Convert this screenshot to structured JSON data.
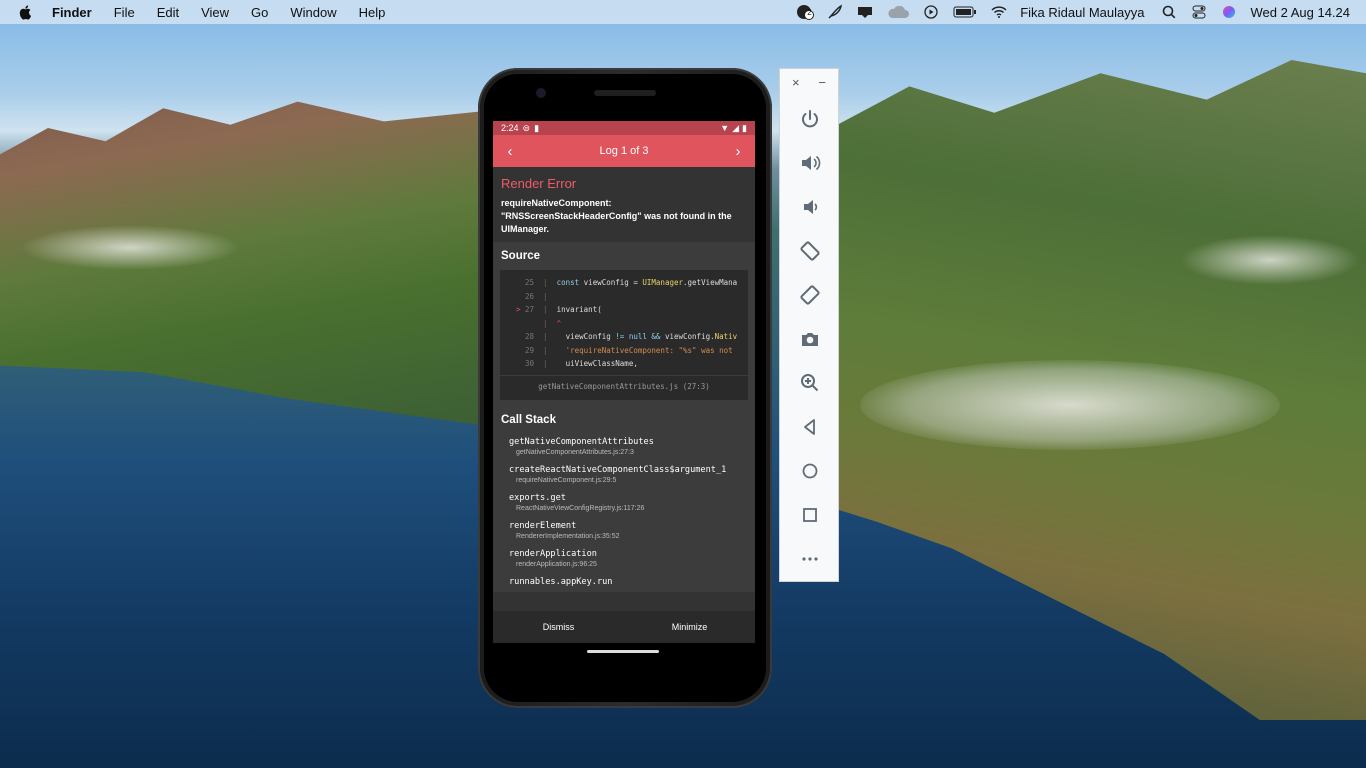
{
  "menubar": {
    "app_name": "Finder",
    "menus": [
      "File",
      "Edit",
      "View",
      "Go",
      "Window",
      "Help"
    ],
    "user": "Fika Ridaul Maulayya",
    "datetime": "Wed 2 Aug  14.24",
    "badge_count": "2"
  },
  "phone": {
    "status_time": "2:24",
    "header_title": "Log 1 of 3",
    "error_title": "Render Error",
    "error_message": "requireNativeComponent: \"RNSScreenStackHeaderConfig\" was not found in the UIManager.",
    "source_title": "Source",
    "source_lines": [
      {
        "num": "25",
        "marker": "",
        "code": "  const viewConfig = UIManager.getViewMana"
      },
      {
        "num": "26",
        "marker": "",
        "code": ""
      },
      {
        "num": "27",
        "marker": ">",
        "code": "  invariant("
      },
      {
        "num": "",
        "marker": "",
        "code": "  ^"
      },
      {
        "num": "28",
        "marker": "",
        "code": "    viewConfig != null && viewConfig.Nativ"
      },
      {
        "num": "29",
        "marker": "",
        "code": "    'requireNativeComponent: \"%s\" was not"
      },
      {
        "num": "30",
        "marker": "",
        "code": "    uiViewClassName,"
      }
    ],
    "source_file": "getNativeComponentAttributes.js (27:3)",
    "callstack_title": "Call Stack",
    "callstack": [
      {
        "fn": "getNativeComponentAttributes",
        "loc": "getNativeComponentAttributes.js:27:3"
      },
      {
        "fn": "createReactNativeComponentClass$argument_1",
        "loc": "requireNativeComponent.js:29:5"
      },
      {
        "fn": "exports.get",
        "loc": "ReactNativeViewConfigRegistry.js:117:26"
      },
      {
        "fn": "renderElement",
        "loc": "RendererImplementation.js:35:52"
      },
      {
        "fn": "renderApplication",
        "loc": "renderApplication.js:96:25"
      },
      {
        "fn": "runnables.appKey.run",
        "loc": ""
      }
    ],
    "dismiss_label": "Dismiss",
    "minimize_label": "Minimize"
  },
  "emulator_toolbar": {
    "close_glyph": "×",
    "minimize_glyph": "−",
    "buttons": [
      "power-icon",
      "volume-up-icon",
      "volume-down-icon",
      "rotate-left-icon",
      "rotate-right-icon",
      "camera-icon",
      "zoom-icon",
      "back-icon",
      "home-icon",
      "overview-icon",
      "more-icon"
    ]
  }
}
